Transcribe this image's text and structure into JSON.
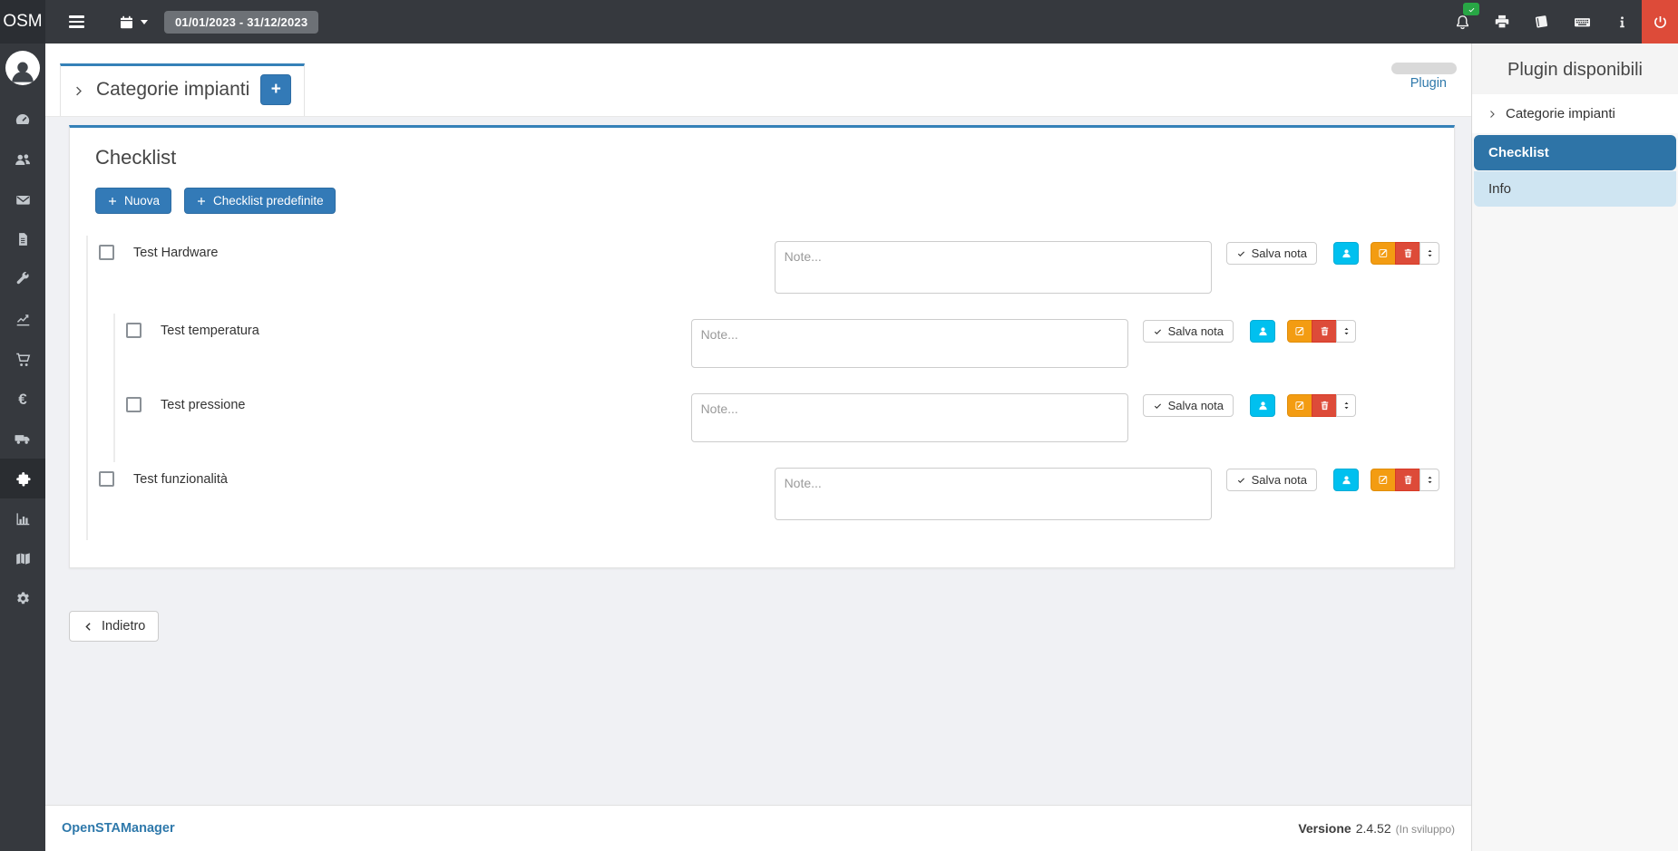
{
  "topbar": {
    "logo": "OSM",
    "date_range": "01/01/2023 - 31/12/2023",
    "right_icons": [
      "bell-icon",
      "printer-icon",
      "book-icon",
      "keyboard-icon",
      "info-icon",
      "power-icon"
    ],
    "notification_badge_icon": "check-icon"
  },
  "sidebar": {
    "items": [
      {
        "name": "dashboard",
        "icon": "tachometer-icon",
        "active": false
      },
      {
        "name": "users",
        "icon": "users-icon",
        "active": false
      },
      {
        "name": "mail",
        "icon": "envelope-icon",
        "active": false
      },
      {
        "name": "documents",
        "icon": "file-icon",
        "active": false
      },
      {
        "name": "interventions",
        "icon": "wrench-icon",
        "active": false
      },
      {
        "name": "reports",
        "icon": "chart-line-icon",
        "active": false
      },
      {
        "name": "orders",
        "icon": "cart-icon",
        "active": false
      },
      {
        "name": "invoices",
        "icon": "euro-icon",
        "active": false
      },
      {
        "name": "shipping",
        "icon": "truck-icon",
        "active": false
      },
      {
        "name": "plants",
        "icon": "puzzle-icon",
        "active": true
      },
      {
        "name": "statistics",
        "icon": "bar-chart-icon",
        "active": false
      },
      {
        "name": "map",
        "icon": "map-icon",
        "active": false
      },
      {
        "name": "settings",
        "icon": "gear-icon",
        "active": false
      }
    ]
  },
  "glyphs": {
    "euro": "€"
  },
  "header": {
    "tab_label": "Categorie impianti",
    "add_button_label": "+",
    "plugin_link_label": "Plugin"
  },
  "checklist": {
    "title": "Checklist",
    "new_button_label": "Nuova",
    "predefined_button_label": "Checklist predefinite",
    "rows": [
      {
        "label": "Test Hardware",
        "level": 0,
        "checked": false,
        "note_value": "",
        "note_placeholder": "Note...",
        "save_label": "Salva nota"
      },
      {
        "label": "Test temperatura",
        "level": 1,
        "checked": false,
        "note_value": "",
        "note_placeholder": "Note...",
        "save_label": "Salva nota"
      },
      {
        "label": "Test pressione",
        "level": 1,
        "checked": false,
        "note_value": "",
        "note_placeholder": "Note...",
        "save_label": "Salva nota"
      },
      {
        "label": "Test funzionalità",
        "level": 0,
        "checked": false,
        "note_value": "",
        "note_placeholder": "Note...",
        "save_label": "Salva nota"
      }
    ]
  },
  "back_button": {
    "label": "Indietro"
  },
  "footer": {
    "brand": "OpenSTAManager",
    "version_label": "Versione",
    "version": "2.4.52",
    "version_note": "(In sviluppo)"
  },
  "plugin_panel": {
    "title": "Plugin disponibili",
    "items": [
      {
        "label": "Categorie impianti",
        "active": false
      },
      {
        "label": "Checklist",
        "active": true
      },
      {
        "label": "Info",
        "active": false
      }
    ]
  },
  "colors": {
    "accent": "#337ab7",
    "accent_border": "#3581b8",
    "info": "#00c0ef",
    "warning": "#f39c12",
    "danger": "#dd4b39",
    "success": "#28a745",
    "navbar": "#36393e",
    "navbar_dark": "#2b2e33",
    "active_nav": "#2e74a7",
    "info_item_bg": "#cfe5f2"
  }
}
